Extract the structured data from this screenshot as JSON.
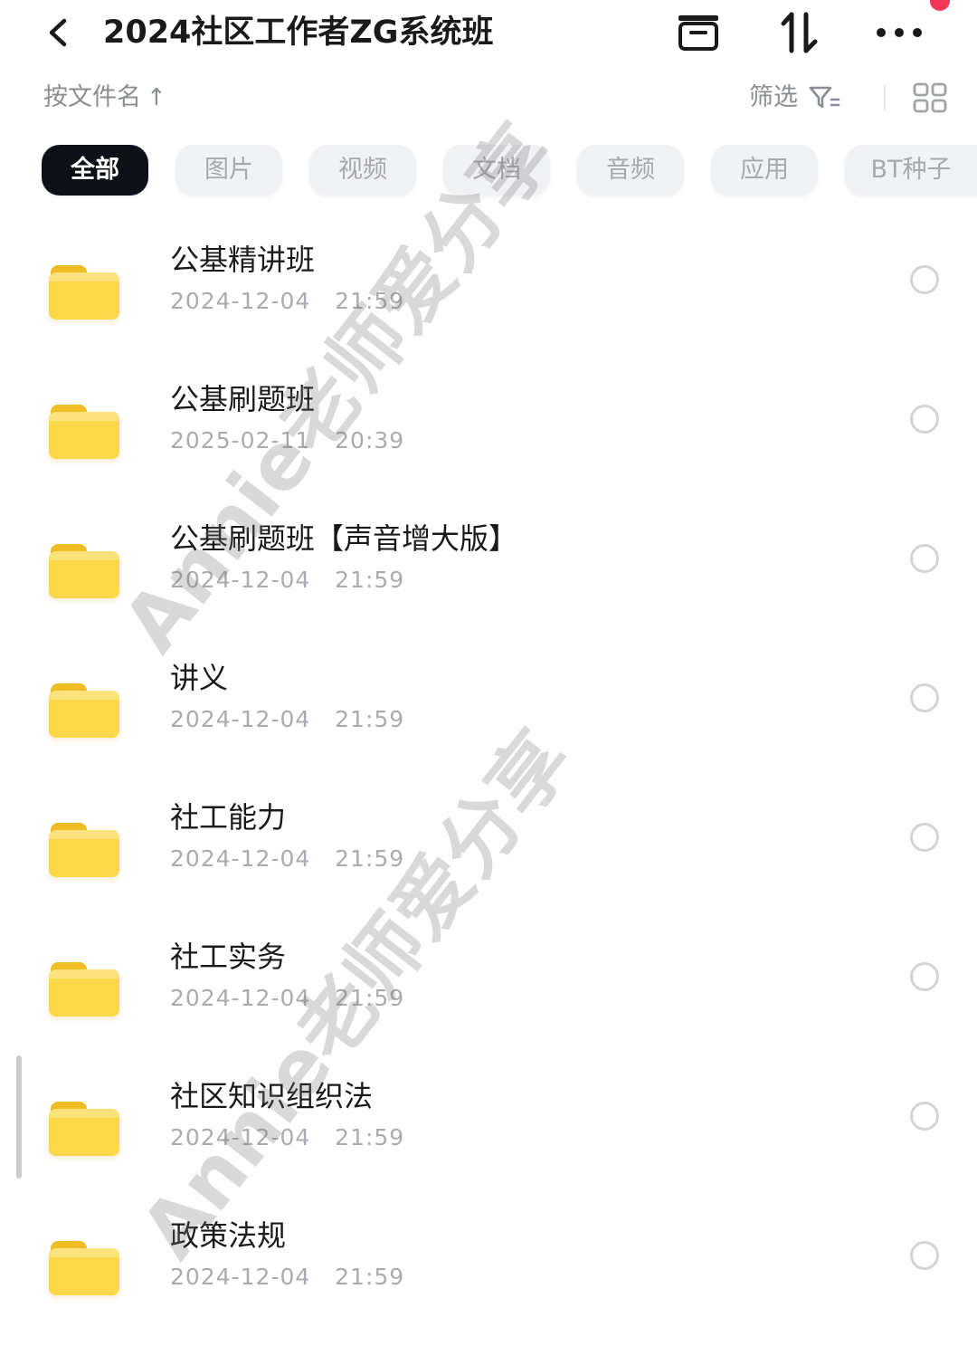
{
  "header": {
    "title": "2024社区工作者ZG系统班",
    "back_icon": "chevron-left-icon",
    "icons": [
      "archive-box-icon",
      "sort-swap-icon",
      "more-dots-icon"
    ],
    "notification_color": "#f2365a"
  },
  "toolbar": {
    "sort_label": "按文件名",
    "sort_arrow": "↑",
    "filter_label": "筛选",
    "filter_icon": "filter-icon",
    "view_icon": "grid-view-icon"
  },
  "categories": [
    {
      "label": "全部",
      "active": true
    },
    {
      "label": "图片",
      "active": false
    },
    {
      "label": "视频",
      "active": false
    },
    {
      "label": "文档",
      "active": false
    },
    {
      "label": "音频",
      "active": false
    },
    {
      "label": "应用",
      "active": false
    },
    {
      "label": "BT种子",
      "active": false
    }
  ],
  "files": [
    {
      "name": "公基精讲班",
      "date": "2024-12-04   21:59",
      "type": "folder"
    },
    {
      "name": "公基刷题班",
      "date": "2025-02-11   20:39",
      "type": "folder"
    },
    {
      "name": "公基刷题班【声音增大版】",
      "date": "2024-12-04   21:59",
      "type": "folder"
    },
    {
      "name": "讲义",
      "date": "2024-12-04   21:59",
      "type": "folder"
    },
    {
      "name": "社工能力",
      "date": "2024-12-04   21:59",
      "type": "folder"
    },
    {
      "name": "社工实务",
      "date": "2024-12-04   21:59",
      "type": "folder"
    },
    {
      "name": "社区知识组织法",
      "date": "2024-12-04   21:59",
      "type": "folder"
    },
    {
      "name": "政策法规",
      "date": "2024-12-04   21:59",
      "type": "folder"
    }
  ],
  "watermark": "Annie老师爱分享",
  "colors": {
    "accent_dark": "#0d1016",
    "folder_yellow": "#fcd74a",
    "muted_text": "#a8abb0"
  }
}
